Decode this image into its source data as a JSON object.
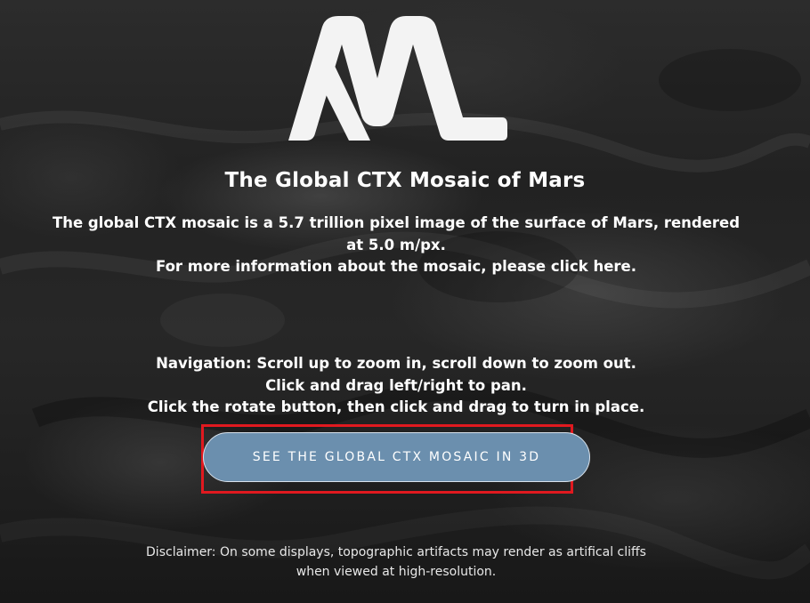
{
  "logo": {
    "name": "ML logo",
    "color": "#f3f3f3"
  },
  "title": "The Global CTX Mosaic of Mars",
  "description": {
    "line1": "The global CTX mosaic is a 5.7 trillion pixel image of the surface of Mars, rendered",
    "line2": "at 5.0 m/px.",
    "line3": "For more information about the mosaic, please click here."
  },
  "navigation": {
    "line1": "Navigation: Scroll up to zoom in, scroll down to zoom out.",
    "line2": "Click and drag left/right to pan.",
    "line3": "Click the rotate button, then click and drag to turn in place."
  },
  "cta": {
    "label": "SEE THE GLOBAL CTX MOSAIC IN 3D",
    "background": "#6b8fae",
    "highlight_color": "#e0191f"
  },
  "disclaimer": {
    "line1": "Disclaimer: On some displays, topographic artifacts may render as artifical cliffs",
    "line2": "when viewed at high-resolution."
  }
}
